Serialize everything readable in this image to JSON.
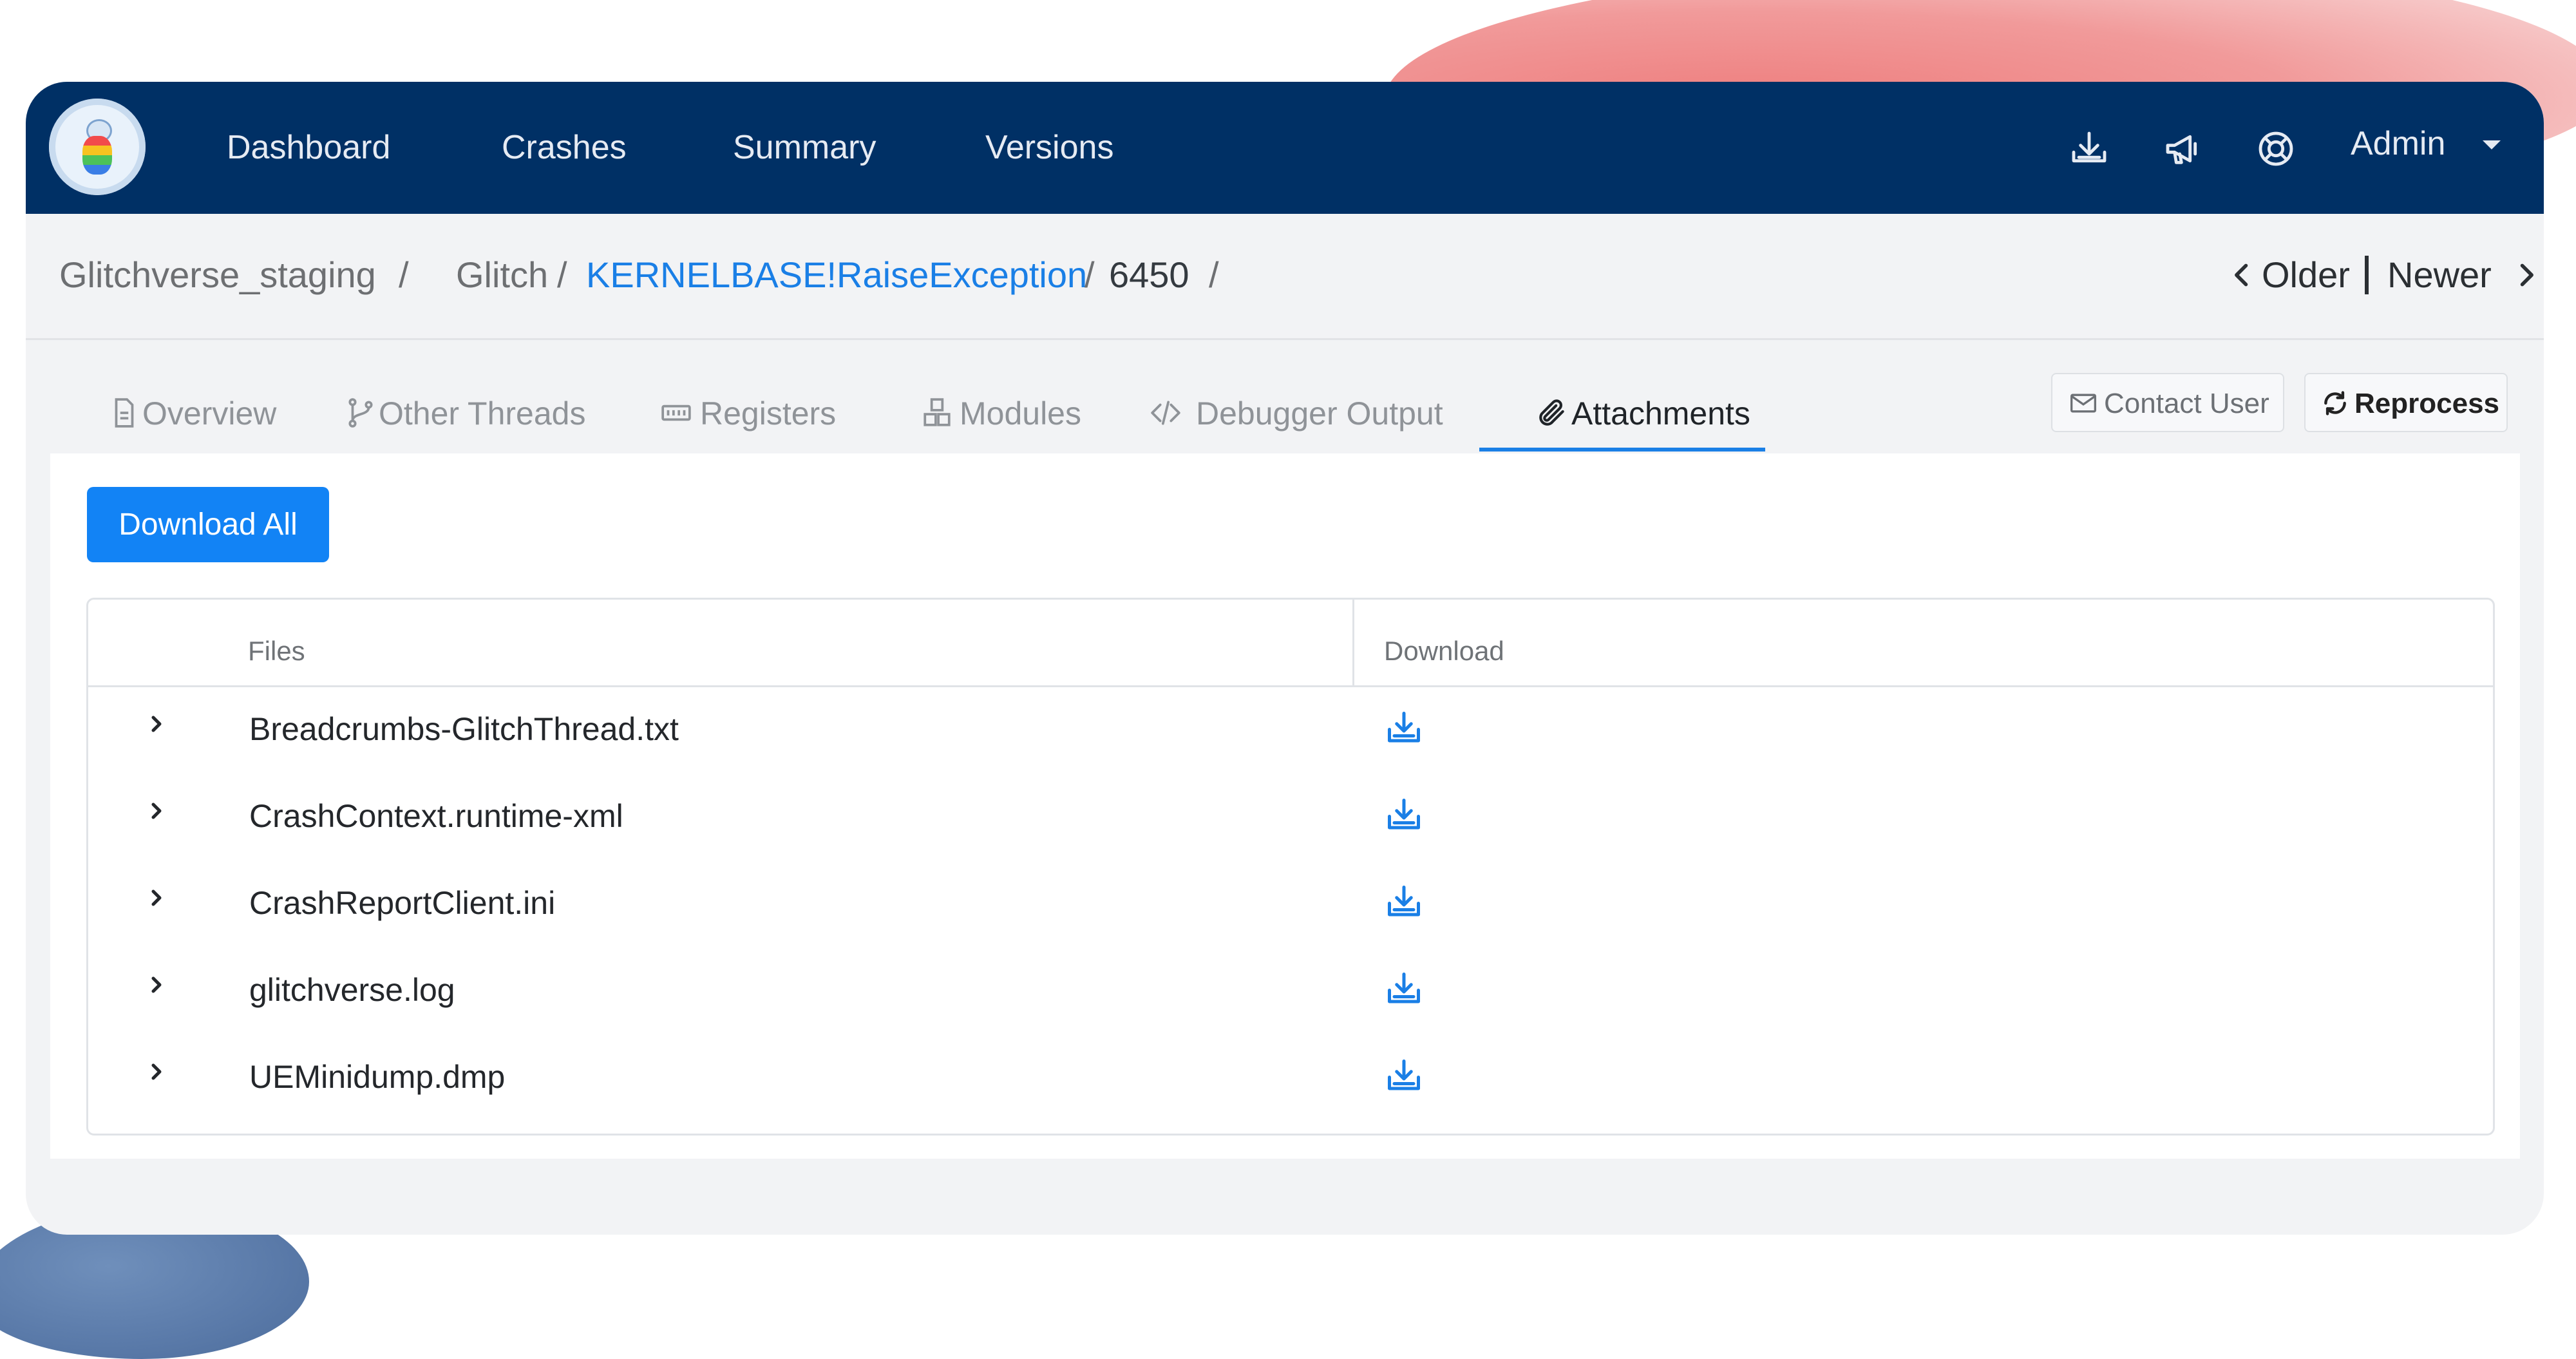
{
  "app": {
    "nav": [
      "Dashboard",
      "Crashes",
      "Summary",
      "Versions"
    ],
    "nav_icons": [
      "download-icon",
      "megaphone-icon",
      "lifebuoy-icon"
    ],
    "admin_label": "Admin"
  },
  "breadcrumb": {
    "project": "Glitchverse_staging",
    "sep1": "/",
    "category": "Glitch",
    "sep2": "/",
    "signature": "KERNELBASE!RaiseException",
    "sep3": "/",
    "crash_id": "6450",
    "sep4": "/"
  },
  "pager": {
    "older": "Older",
    "newer": "Newer"
  },
  "tabs": [
    {
      "label": "Overview",
      "icon": "file-icon"
    },
    {
      "label": "Other Threads",
      "icon": "branch-icon"
    },
    {
      "label": "Registers",
      "icon": "memory-icon"
    },
    {
      "label": "Modules",
      "icon": "cubes-icon"
    },
    {
      "label": "Debugger Output",
      "icon": "code-icon"
    },
    {
      "label": "Attachments",
      "icon": "paperclip-icon",
      "active": true
    }
  ],
  "actions": {
    "contact": "Contact User",
    "reprocess": "Reprocess"
  },
  "attachments": {
    "download_all": "Download All",
    "headers": {
      "files": "Files",
      "download": "Download"
    },
    "files": [
      "Breadcrumbs-GlitchThread.txt",
      "CrashContext.runtime-xml",
      "CrashReportClient.ini",
      "glitchverse.log",
      "UEMinidump.dmp"
    ]
  },
  "colors": {
    "navbar": "#003065",
    "accent": "#1a7fe6",
    "primary_button": "#1283f5"
  }
}
